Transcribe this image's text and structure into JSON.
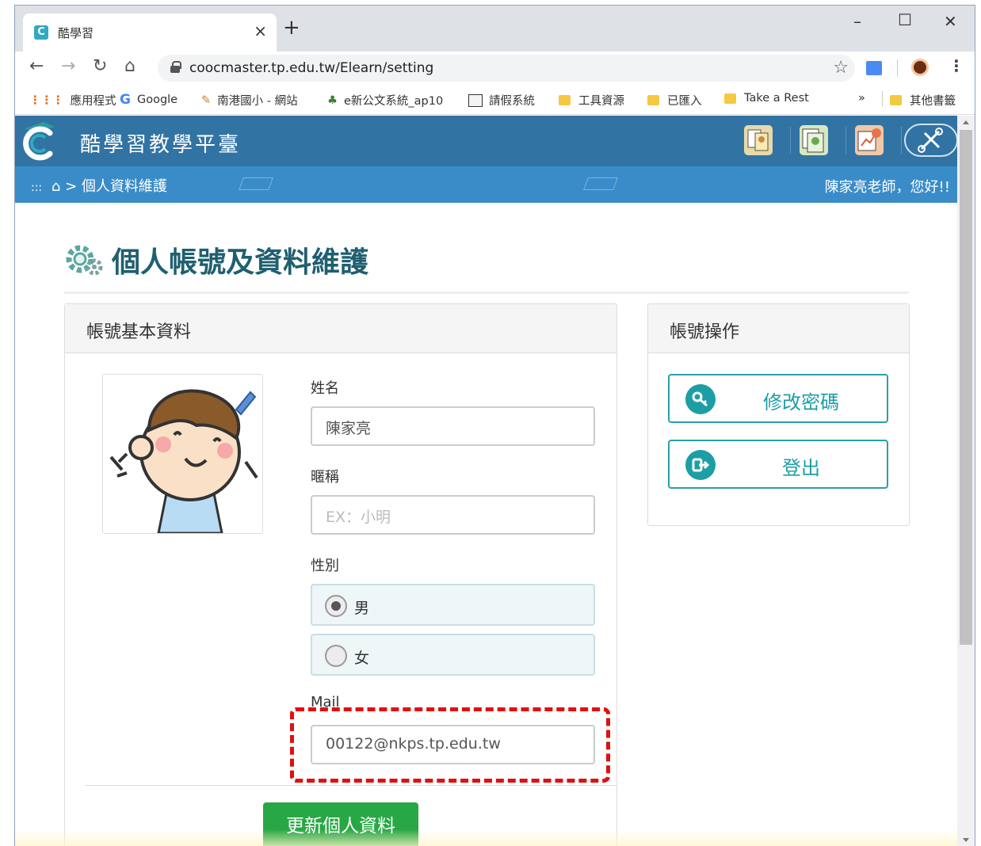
{
  "browser": {
    "tab_title": "酷學習",
    "tab_close": "×",
    "new_tab": "+",
    "win_minimize": "–",
    "win_maximize": "☐",
    "win_close": "✕",
    "url": "coocmaster.tp.edu.tw/Elearn/setting",
    "bookmarks": [
      {
        "label": "應用程式",
        "icon": "apps-grid-icon"
      },
      {
        "label": "Google",
        "icon": "google-icon"
      },
      {
        "label": "南港國小 - 網站",
        "icon": "pencil-ruler-icon"
      },
      {
        "label": "e新公文系統_ap10",
        "icon": "e-doc-icon"
      },
      {
        "label": "請假系統",
        "icon": "leave-system-icon"
      },
      {
        "label": "工具資源",
        "icon": "folder-icon"
      },
      {
        "label": "已匯入",
        "icon": "folder-icon"
      },
      {
        "label": "Take a Rest",
        "icon": "folder-icon"
      },
      {
        "label": "其他書籤",
        "icon": "folder-icon"
      }
    ],
    "overflow": "»"
  },
  "site": {
    "title": "酷學習教學平臺",
    "breadcrumb_prefix": ":::",
    "breadcrumb_sep": ">",
    "breadcrumb_current": "個人資料維護",
    "greeting": "陳家亮老師，您好!!"
  },
  "page": {
    "title": "個人帳號及資料維護"
  },
  "profile_panel": {
    "heading": "帳號基本資料",
    "name_label": "姓名",
    "name_value": "陳家亮",
    "nickname_label": "暱稱",
    "nickname_placeholder": "EX：小明",
    "gender_label": "性別",
    "gender_options": [
      {
        "label": "男",
        "checked": true
      },
      {
        "label": "女",
        "checked": false
      }
    ],
    "mail_label": "Mail",
    "mail_value": "00122@nkps.tp.edu.tw",
    "submit_label": "更新個人資料"
  },
  "account_panel": {
    "heading": "帳號操作",
    "change_password_label": "修改密碼",
    "logout_label": "登出"
  },
  "colors": {
    "header_bg": "#3173a3",
    "breadcrumb_bg": "#3a8cc8",
    "accent_teal": "#1c9ea4",
    "title_color": "#1f5f70",
    "submit_green": "#28a745",
    "highlight_red": "#e01010"
  }
}
